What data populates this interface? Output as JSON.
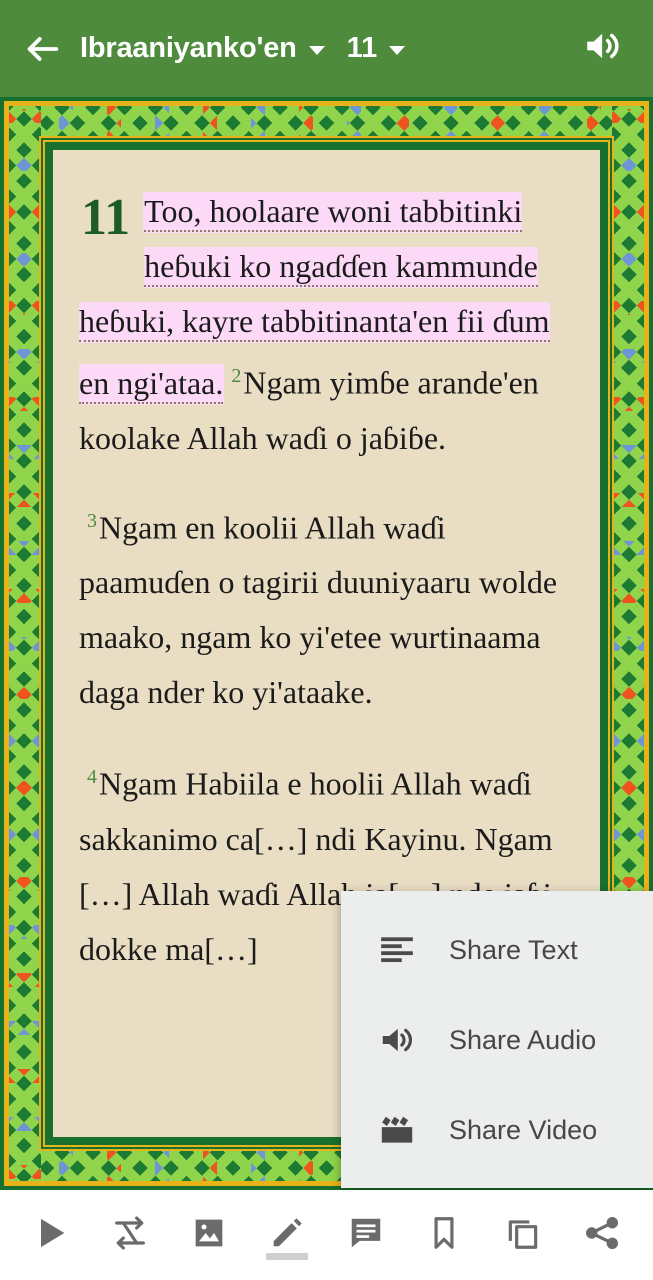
{
  "header": {
    "back_icon": "arrow-left-icon",
    "book_title": "Ibraaniyanko'en",
    "book_dropdown_icon": "chevron-down-icon",
    "chapter": "11",
    "chapter_dropdown_icon": "chevron-down-icon",
    "audio_icon": "speaker-icon",
    "background_color": "#4e8b3c",
    "text_color": "#ffffff"
  },
  "page": {
    "paper_color": "#e9ddc3",
    "frame_color": "#18702f",
    "gold_color": "#e8b21b",
    "chapter_number": "11",
    "highlight_color": "#fbd9f7",
    "verse_number_color": "#4e8b3c",
    "paragraphs": [
      {
        "verse": "1",
        "show_verse_number": false,
        "highlighted_text": "Too, hoolaare woni tabbitinki heɓuki ko ngaɗɗen kammunde heɓuki, kayre tabbitinanta'en fii ɗum en ngi'ataa.",
        "verse2_number": "2",
        "verse2_text": "Ngam yimɓe arande'en koolake Allah waɗi o jaɓiɓe."
      },
      {
        "verse": "3",
        "show_verse_number": true,
        "text": "Ngam en koolii Allah waɗi paamuɗen o tagirii duuniyaaru wolde maako, ngam ko yi'etee wurtinaama daga nder ko yi'ataake."
      },
      {
        "verse": "4",
        "show_verse_number": true,
        "text": "Ngam Habiila e hoolii Allah waɗi sakkanimo ca[…] ndi Kayinu. Ngam […] Allah waɗi Allah ja[…] nde jaɓi dokke ma[…]"
      }
    ]
  },
  "share_popup": {
    "background_color": "#eceded",
    "items": [
      {
        "label": "Share Text",
        "icon": "align-left-icon"
      },
      {
        "label": "Share Audio",
        "icon": "speaker-icon"
      },
      {
        "label": "Share Video",
        "icon": "clapperboard-icon"
      }
    ]
  },
  "toolbar": {
    "background_color": "#ffffff",
    "icon_color": "#6b6b6b",
    "items": [
      {
        "name": "play-button",
        "icon": "play-icon",
        "active": false
      },
      {
        "name": "repeat-button",
        "icon": "repeat-icon",
        "active": false
      },
      {
        "name": "image-button",
        "icon": "image-icon",
        "active": false
      },
      {
        "name": "highlight-button",
        "icon": "pencil-icon",
        "active": true
      },
      {
        "name": "note-button",
        "icon": "comment-icon",
        "active": false
      },
      {
        "name": "bookmark-button",
        "icon": "bookmark-icon",
        "active": false
      },
      {
        "name": "copy-button",
        "icon": "copy-icon",
        "active": false
      },
      {
        "name": "share-button",
        "icon": "share-icon",
        "active": false
      }
    ]
  }
}
